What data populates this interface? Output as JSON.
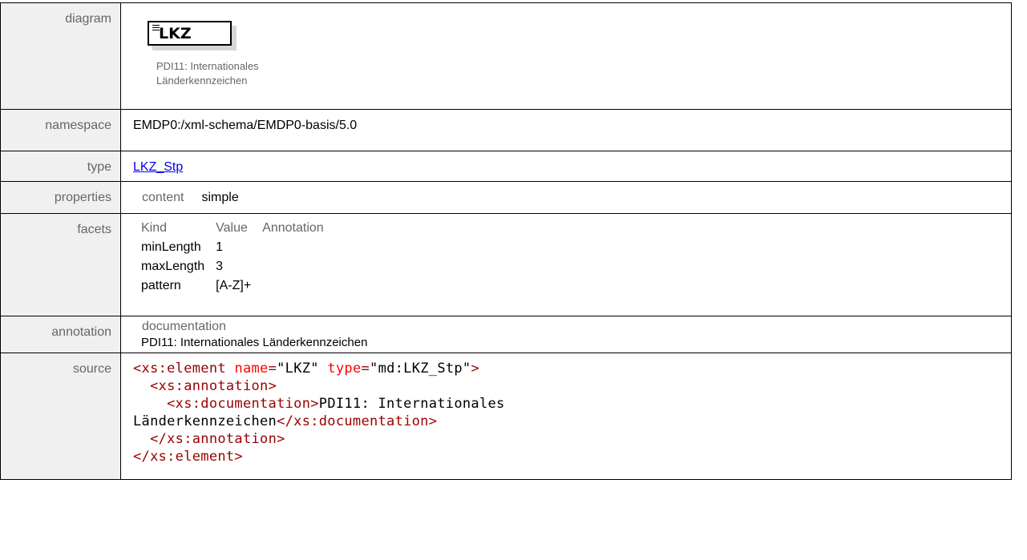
{
  "top_caption": "diagram  ·  namespace  ·  type  ·  properties  ·  facets  ·  annotation  ·  source",
  "rows": {
    "diagram": {
      "label": "diagram",
      "element_name": "LKZ",
      "doc_line1": "PDI11: Internationales",
      "doc_line2": "Länderkennzeichen"
    },
    "namespace": {
      "label": "namespace",
      "value": "EMDP0:/xml-schema/EMDP0-basis/5.0"
    },
    "type": {
      "label": "type",
      "value": "LKZ_Stp"
    },
    "properties": {
      "label": "properties",
      "key": "content",
      "value": "simple"
    },
    "facets": {
      "label": "facets",
      "headers": [
        "Kind",
        "Value",
        "Annotation"
      ],
      "items": [
        {
          "kind": "minLength",
          "value": "1",
          "annotation": ""
        },
        {
          "kind": "maxLength",
          "value": "3",
          "annotation": ""
        },
        {
          "kind": "pattern",
          "value": "[A-Z]+",
          "annotation": ""
        }
      ]
    },
    "annotation": {
      "label": "annotation",
      "head": "documentation",
      "text": "PDI11: Internationales Länderkennzeichen"
    },
    "source": {
      "label": "source",
      "lines": {
        "l1_open": "<xs:element",
        "l1_attr1": "name",
        "l1_val1": "\"LKZ\"",
        "l1_attr2": "type",
        "l1_val2": "\"md:LKZ_Stp\"",
        "l1_close": ">",
        "l2": "<xs:annotation>",
        "l3_tag": "<xs:documentation>",
        "l3_text": "PDI11: Internationales",
        "l4_text": "Länderkennzeichen",
        "l4_tag": "</xs:documentation>",
        "l5": "</xs:annotation>",
        "l6": "</xs:element>"
      }
    }
  }
}
